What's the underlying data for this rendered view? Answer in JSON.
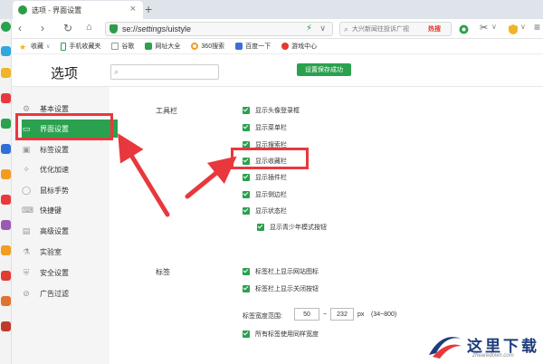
{
  "browser": {
    "tab_title": "选项 - 界面设置",
    "tab_close": "×",
    "new_tab": "+",
    "url_scheme": "se://",
    "url_path": "settings",
    "url_rest": "/uistyle",
    "search_placeholder": "大兴新闻往投诉广视",
    "search_hot": "热搜",
    "bookmarks": [
      {
        "label": "收藏",
        "icon": "star-icon",
        "color": "#f0b428"
      },
      {
        "label": "手机收藏夹",
        "icon": "phone-icon",
        "color": "#2aa14e"
      },
      {
        "label": "谷歌",
        "icon": "google-icon",
        "color": "#777777"
      },
      {
        "label": "网址大全",
        "icon": "globe-icon",
        "color": "#2aa14e"
      },
      {
        "label": "360搜索",
        "icon": "search360-icon",
        "color": "#f39c1f"
      },
      {
        "label": "百度一下",
        "icon": "baidu-icon",
        "color": "#3b6fd8"
      },
      {
        "label": "游戏中心",
        "icon": "game-icon",
        "color": "#e23b2f"
      }
    ]
  },
  "settings": {
    "title": "选项",
    "save_status": "设置保存成功",
    "nav": [
      {
        "label": "基本设置",
        "icon": "gear-icon"
      },
      {
        "label": "界面设置",
        "icon": "window-icon",
        "active": true
      },
      {
        "label": "标签设置",
        "icon": "tab-icon"
      },
      {
        "label": "优化加速",
        "icon": "rocket-icon"
      },
      {
        "label": "鼠标手势",
        "icon": "mouse-icon"
      },
      {
        "label": "快捷键",
        "icon": "keyboard-icon"
      },
      {
        "label": "高级设置",
        "icon": "advanced-icon"
      },
      {
        "label": "实验室",
        "icon": "flask-icon"
      },
      {
        "label": "安全设置",
        "icon": "shield-icon"
      },
      {
        "label": "广告过滤",
        "icon": "block-icon"
      }
    ],
    "toolbar_section": {
      "label": "工具栏",
      "options": [
        "显示头像登录框",
        "显示菜单栏",
        "显示搜索栏",
        "显示收藏栏",
        "显示插件栏",
        "显示侧边栏",
        "显示状态栏"
      ],
      "sub_option": "显示青少年模式按钮"
    },
    "tabs_section": {
      "label": "标签",
      "options": [
        "标签栏上显示网站图标",
        "标签栏上显示关闭按钮"
      ],
      "width_label": "标签宽度范围:",
      "width_min": "50",
      "width_sep": "~",
      "width_max": "232",
      "width_unit": "px",
      "width_hint": "(34~800)",
      "same_width_option": "所有标签使用同样宽度"
    }
  },
  "watermark": {
    "text": "这里下载",
    "sub": "zhearedown.com"
  },
  "colors": {
    "accent_green": "#2aa14e",
    "annotation_red": "#e8383d"
  }
}
